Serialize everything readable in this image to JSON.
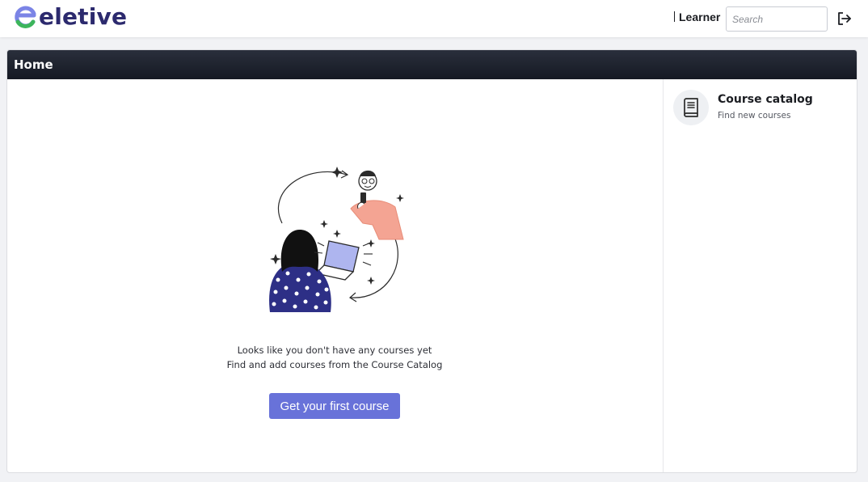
{
  "brand": {
    "name": "eletive"
  },
  "header": {
    "role": "Learner",
    "search_placeholder": "Search"
  },
  "page": {
    "title": "Home"
  },
  "empty_state": {
    "line1": "Looks like you don't have any courses yet",
    "line2": "Find and add courses from the Course Catalog",
    "cta_label": "Get your first course"
  },
  "sidebar": {
    "catalog": {
      "title": "Course catalog",
      "subtitle": "Find new courses",
      "icon": "book-icon"
    }
  },
  "colors": {
    "brand_text": "#2c2a6e",
    "brand_green": "#3cb55b",
    "brand_purple": "#6872d9",
    "header_dark": "#151923",
    "cta": "#6872d9"
  }
}
